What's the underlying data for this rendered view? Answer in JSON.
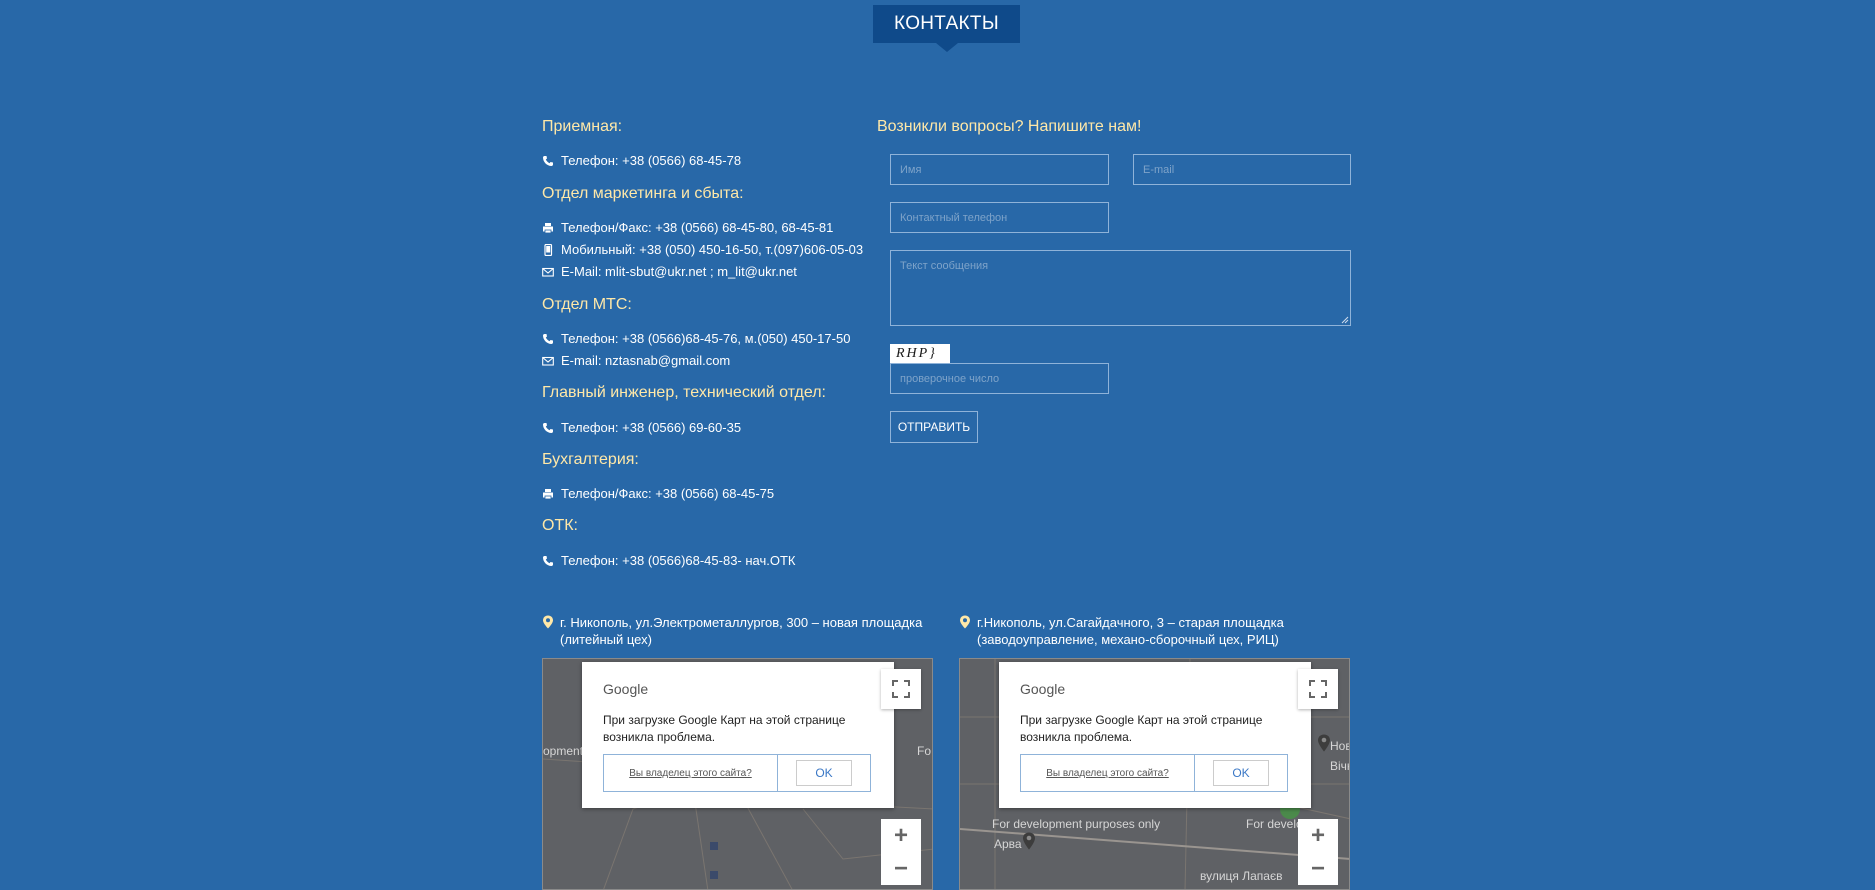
{
  "header": {
    "title": "КОНТАКТЫ"
  },
  "contacts": {
    "sections": [
      {
        "title": "Приемная:",
        "lines": [
          {
            "icon": "phone-icon",
            "text": "Телефон: +38 (0566) 68-45-78"
          }
        ]
      },
      {
        "title": "Отдел маркетинга и сбыта:",
        "lines": [
          {
            "icon": "fax-icon",
            "text": "Телефон/Факс: +38 (0566) 68-45-80, 68-45-81"
          },
          {
            "icon": "mobile-icon",
            "text": "Мобильный: +38 (050) 450-16-50, т.(097)606-05-03"
          },
          {
            "icon": "mail-icon",
            "text": "E-Mail: mlit-sbut@ukr.net ; m_lit@ukr.net"
          }
        ]
      },
      {
        "title": "Отдел МТС:",
        "lines": [
          {
            "icon": "phone-icon",
            "text": "Телефон: +38 (0566)68-45-76, м.(050) 450-17-50"
          },
          {
            "icon": "mail-icon",
            "text": "E-mail: nztasnab@gmail.com"
          }
        ]
      },
      {
        "title": "Главный инженер, технический отдел:",
        "lines": [
          {
            "icon": "phone-icon",
            "text": "Телефон: +38 (0566) 69-60-35"
          }
        ]
      },
      {
        "title": "Бухгалтерия:",
        "lines": [
          {
            "icon": "fax-icon",
            "text": "Телефон/Факс: +38 (0566) 68-45-75"
          }
        ]
      },
      {
        "title": "ОТК:",
        "lines": [
          {
            "icon": "phone-icon",
            "text": "Телефон: +38 (0566)68-45-83- нач.ОТК"
          }
        ]
      }
    ]
  },
  "form": {
    "title": "Возникли вопросы? Напишите нам!",
    "name_placeholder": "Имя",
    "email_placeholder": "E-mail",
    "phone_placeholder": "Контактный телефон",
    "message_placeholder": "Текст сообщения",
    "captcha_text": "RHP}",
    "captcha_placeholder": "проверочное число",
    "submit_label": "ОТПРАВИТЬ"
  },
  "maps": [
    {
      "address_line1": "г. Никополь, ул.Электрометаллургов, 300 – новая площадка",
      "address_line2": "(литейный цех)",
      "labels": [
        "opment",
        "Fo"
      ],
      "dialog": {
        "logo": "Google",
        "message": "При загрузке Google Карт на этой странице возникла проблема.",
        "owner_link": "Вы владелец этого сайта?",
        "ok_label": "OK"
      },
      "zoom_in": "+",
      "zoom_out": "−"
    },
    {
      "address_line1": "г.Никополь, ул.Сагайдачного, 3 – старая площадка",
      "address_line2": "(заводоуправление, механо-сборочный цех, РИЦ)",
      "labels": [
        "For development purposes only",
        "For development",
        "Арва",
        "Нов",
        "Вічної",
        "вулиця Лапаєв"
      ],
      "dialog": {
        "logo": "Google",
        "message": "При загрузке Google Карт на этой странице возникла проблема.",
        "owner_link": "Вы владелец этого сайта?",
        "ok_label": "OK"
      },
      "zoom_in": "+",
      "zoom_out": "−"
    }
  ],
  "colors": {
    "background": "#2868a8",
    "header": "#0f4a8a",
    "heading": "#ffe8a8"
  }
}
